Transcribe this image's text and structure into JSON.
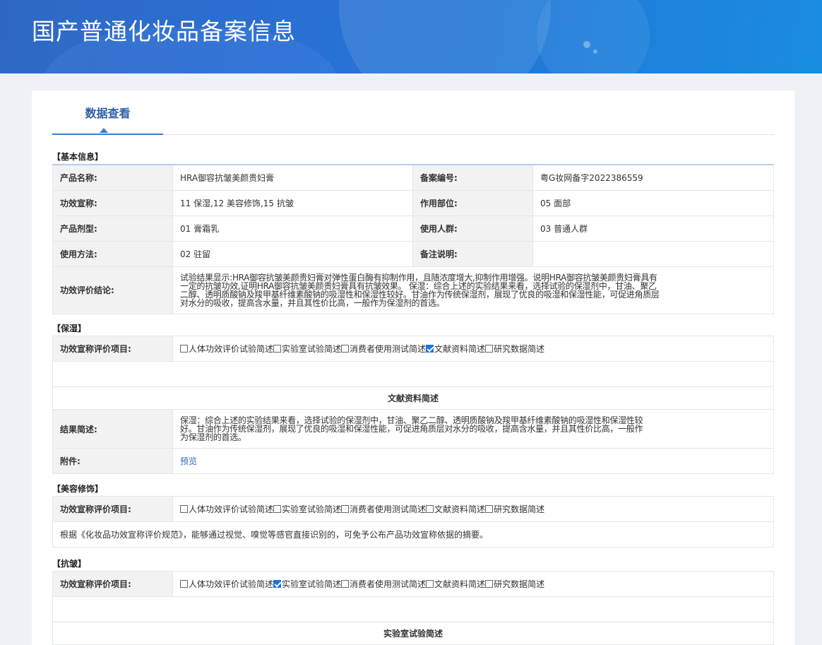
{
  "banner": {
    "title": "国产普通化妆品备案信息"
  },
  "tabs": [
    {
      "label": "数据查看"
    }
  ],
  "basic": {
    "title": "【基本信息】",
    "rows": [
      {
        "l1": "产品名称:",
        "v1": "HRA御容抗皱美颜贵妇膏",
        "l2": "备案编号:",
        "v2": "粤G妆网备字2022386559"
      },
      {
        "l1": "功效宣称:",
        "v1": "11 保湿,12 美容修饰,15 抗皱",
        "l2": "作用部位:",
        "v2": "05 面部"
      },
      {
        "l1": "产品剂型:",
        "v1": "01 膏霜乳",
        "l2": "使用人群:",
        "v2": "03 普通人群"
      },
      {
        "l1": "使用方法:",
        "v1": "02 驻留",
        "l2": "备注说明:",
        "v2": ""
      }
    ],
    "conclusion_label": "功效评价结论:",
    "conclusion": "试验结果显示:HRA御容抗皱美颜贵妇膏对弹性蛋白酶有抑制作用，且随浓度增大,抑制作用增强。说明HRA御容抗皱美颜贵妇膏具有一定的抗皱功效,证明HRA御容抗皱美颜贵妇膏具有抗皱效果。 保湿：综合上述的实验结果来看，选择试验的保湿剂中，甘油、聚乙二醇、透明质酸钠及羧甲基纤维素酸钠的吸湿性和保湿性较好。甘油作为传统保湿剂，展现了优良的吸湿和保湿性能，可促进角质层对水分的吸收，提高含水量，并且其性价比高，一般作为保湿剂的首选。"
  },
  "options": [
    "人体功效评价试验简述",
    "实验室试验简述",
    "消费者使用测试简述",
    "文献资料简述",
    "研究数据简述"
  ],
  "moisturize": {
    "title": "【保湿】",
    "eval_label": "功效宣称评价项目:",
    "checked": [
      false,
      false,
      false,
      true,
      false
    ],
    "subheading": "文献资料简述",
    "result_label": "结果简述:",
    "result": "保湿：综合上述的实验结果来看，选择试验的保湿剂中，甘油、聚乙二醇、透明质酸钠及羧甲基纤维素酸钠的吸湿性和保湿性较好。甘油作为传统保湿剂，展现了优良的吸湿和保湿性能，可促进角质层对水分的吸收，提高含水量，并且其性价比高，一般作为保湿剂的首选。",
    "attach_label": "附件:",
    "attach_link": "预览"
  },
  "beauty": {
    "title": "【美容修饰】",
    "eval_label": "功效宣称评价项目:",
    "checked": [
      false,
      false,
      false,
      false,
      false
    ],
    "note": "根据《化妆品功效宣称评价规范》，能够通过视觉、嗅觉等感官直接识别的，可免予公布产品功效宣称依据的摘要。"
  },
  "antiwrinkle": {
    "title": "【抗皱】",
    "eval_label": "功效宣称评价项目:",
    "checked": [
      false,
      true,
      false,
      false,
      false
    ],
    "subheading": "实验室试验简述"
  },
  "colors": {
    "accent": "#3a7bd5",
    "link": "#2b6cb8",
    "checkbox_on": "#1a73e8",
    "label_bg": "#f2f2f2"
  }
}
